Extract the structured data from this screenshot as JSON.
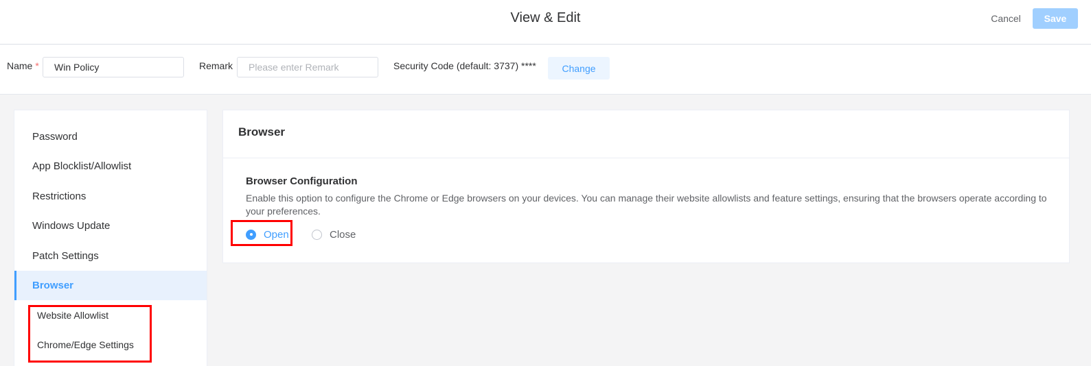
{
  "header": {
    "title": "View & Edit",
    "cancel_label": "Cancel",
    "save_label": "Save"
  },
  "form": {
    "name_label": "Name",
    "required_mark": "*",
    "name_value": "Win Policy",
    "remark_label": "Remark",
    "remark_placeholder": "Please enter Remark",
    "security_code_text": "Security Code (default: 3737) ****",
    "change_label": "Change"
  },
  "sidebar": {
    "items": [
      {
        "label": "Password"
      },
      {
        "label": "App Blocklist/Allowlist"
      },
      {
        "label": "Restrictions"
      },
      {
        "label": "Windows Update"
      },
      {
        "label": "Patch Settings"
      },
      {
        "label": "Browser"
      }
    ],
    "sub_items": [
      {
        "label": "Website Allowlist"
      },
      {
        "label": "Chrome/Edge Settings"
      }
    ],
    "active_index": 5
  },
  "panel": {
    "title": "Browser",
    "section_title": "Browser Configuration",
    "section_desc": "Enable this option to configure the Chrome or Edge browsers on your devices. You can manage their website allowlists and feature settings, ensuring that the browsers operate according to your preferences.",
    "options": [
      {
        "label": "Open"
      },
      {
        "label": "Close"
      }
    ],
    "selected_option": "Open"
  },
  "colors": {
    "accent": "#409eff",
    "highlight": "#ff0000",
    "save_disabled": "#a0cfff"
  }
}
